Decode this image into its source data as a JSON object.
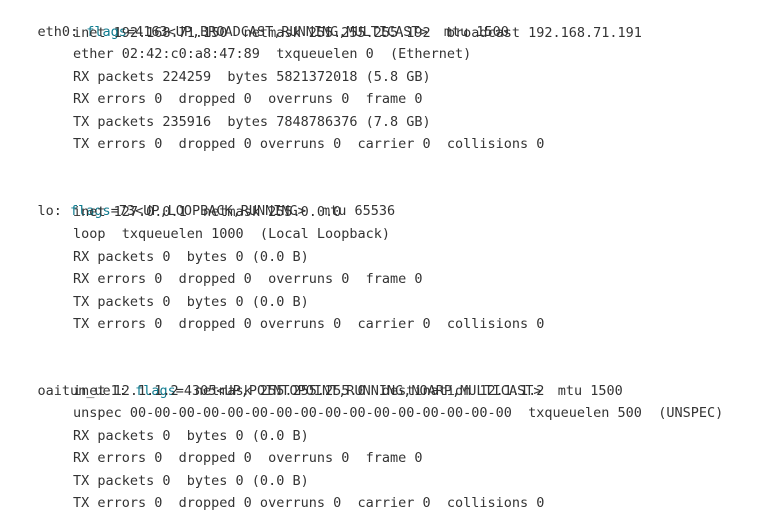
{
  "window": {
    "title": ""
  },
  "colors": {
    "background": "#ffffff",
    "text": "#333333",
    "flags_key": "#0f7b8f"
  },
  "interfaces": [
    {
      "name": "eth0:",
      "flags_key": "flags",
      "flags_value": "=4163<UP,BROADCAST,RUNNING,MULTICAST>  mtu 1500",
      "lines": [
        "inet 192.168.71.150  netmask 255.255.255.192  broadcast 192.168.71.191",
        "ether 02:42:c0:a8:47:89  txqueuelen 0  (Ethernet)",
        "RX packets 224259  bytes 5821372018 (5.8 GB)",
        "RX errors 0  dropped 0  overruns 0  frame 0",
        "TX packets 235916  bytes 7848786376 (7.8 GB)",
        "TX errors 0  dropped 0 overruns 0  carrier 0  collisions 0"
      ]
    },
    {
      "name": "lo:",
      "flags_key": "flags",
      "flags_value": "=73<UP,LOOPBACK,RUNNING>  mtu 65536",
      "lines": [
        "inet 127.0.0.1  netmask 255.0.0.0",
        "loop  txqueuelen 1000  (Local Loopback)",
        "RX packets 0  bytes 0 (0.0 B)",
        "RX errors 0  dropped 0  overruns 0  frame 0",
        "TX packets 0  bytes 0 (0.0 B)",
        "TX errors 0  dropped 0 overruns 0  carrier 0  collisions 0"
      ]
    },
    {
      "name": "oaitun_ue1:",
      "flags_key": "flags",
      "flags_value": "=4305<UP,POINTOPOINT,RUNNING,NOARP,MULTICAST>  mtu 1500",
      "lines": [
        "inet 12.1.1.2  netmask 255.255.255.0  destination 12.1.1.2",
        "unspec 00-00-00-00-00-00-00-00-00-00-00-00-00-00-00-00  txqueuelen 500  (UNSPEC)",
        "RX packets 0  bytes 0 (0.0 B)",
        "RX errors 0  dropped 0  overruns 0  frame 0",
        "TX packets 0  bytes 0 (0.0 B)",
        "TX errors 0  dropped 0 overruns 0  carrier 0  collisions 0"
      ]
    }
  ]
}
